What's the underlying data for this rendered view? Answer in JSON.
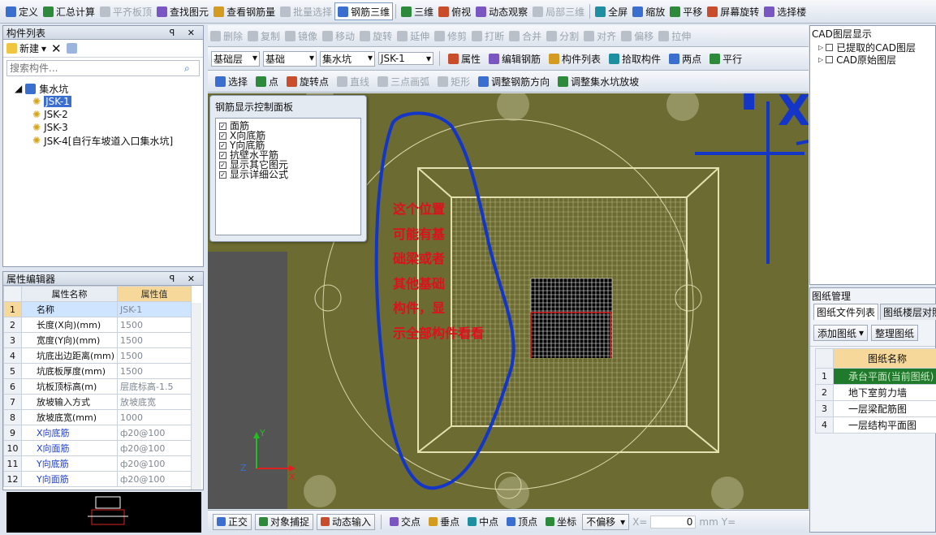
{
  "toolbar1": {
    "items": [
      {
        "icon": "define-icon",
        "label": "定义",
        "disabled": false
      },
      {
        "icon": "sigma-icon",
        "label": "汇总计算",
        "disabled": false
      },
      {
        "icon": "align-slab-icon",
        "label": "平齐板顶",
        "disabled": true
      },
      {
        "icon": "binoculars-icon",
        "label": "查找图元",
        "disabled": false
      },
      {
        "icon": "view-rebar-icon",
        "label": "查看钢筋量",
        "disabled": false
      },
      {
        "icon": "batch-select-icon",
        "label": "批量选择",
        "disabled": true
      },
      {
        "icon": "rebar-3d-icon",
        "label": "钢筋三维",
        "disabled": false
      },
      {
        "icon": "cube-3d-icon",
        "label": "三维",
        "disabled": false
      },
      {
        "icon": "top-view-icon",
        "label": "俯视",
        "disabled": false
      },
      {
        "icon": "orbit-icon",
        "label": "动态观察",
        "disabled": false
      },
      {
        "icon": "local-3d-icon",
        "label": "局部三维",
        "disabled": true
      },
      {
        "icon": "fullscreen-icon",
        "label": "全屏",
        "disabled": false
      },
      {
        "icon": "zoom-icon",
        "label": "缩放",
        "disabled": false
      },
      {
        "icon": "pan-icon",
        "label": "平移",
        "disabled": false
      },
      {
        "icon": "screen-rotate-icon",
        "label": "屏幕旋转",
        "disabled": false
      },
      {
        "icon": "select-floor-icon",
        "label": "选择楼",
        "disabled": false
      }
    ]
  },
  "toolbar2": {
    "items": [
      "删除",
      "复制",
      "镜像",
      "移动",
      "旋转",
      "延伸",
      "修剪",
      "打断",
      "合并",
      "分割",
      "对齐",
      "偏移",
      "拉伸"
    ]
  },
  "toolbar3": {
    "floor": "基础层",
    "category": "基础",
    "type": "集水坑",
    "element": "JSK-1",
    "buttons": [
      "属性",
      "编辑钢筋",
      "构件列表",
      "拾取构件",
      "两点",
      "平行"
    ]
  },
  "toolbar4": {
    "items": [
      "选择",
      "点",
      "旋转点",
      "直线",
      "三点画弧",
      "矩形",
      "调整钢筋方向",
      "调整集水坑放坡"
    ]
  },
  "component_list": {
    "title": "构件列表",
    "new_label": "新建",
    "search_placeholder": "搜索构件...",
    "root": "集水坑",
    "items": [
      "JSK-1",
      "JSK-2",
      "JSK-3",
      "JSK-4[自行车坡道入口集水坑]"
    ],
    "selected_index": 0
  },
  "property_editor": {
    "title": "属性编辑器",
    "col_name": "属性名称",
    "col_value": "属性值",
    "rows": [
      {
        "n": "1",
        "name": "名称",
        "value": "JSK-1",
        "blue": false
      },
      {
        "n": "2",
        "name": "长度(X向)(mm)",
        "value": "1500",
        "blue": false
      },
      {
        "n": "3",
        "name": "宽度(Y向)(mm)",
        "value": "1500",
        "blue": false
      },
      {
        "n": "4",
        "name": "坑底出边距离(mm)",
        "value": "1500",
        "blue": false
      },
      {
        "n": "5",
        "name": "坑底板厚度(mm)",
        "value": "1500",
        "blue": false
      },
      {
        "n": "6",
        "name": "坑板顶标高(m)",
        "value": "层底标高-1.5",
        "blue": false
      },
      {
        "n": "7",
        "name": "放坡输入方式",
        "value": "放坡底宽",
        "blue": false
      },
      {
        "n": "8",
        "name": "放坡底宽(mm)",
        "value": "1000",
        "blue": false
      },
      {
        "n": "9",
        "name": "X向底筋",
        "value": "ф20@100",
        "blue": true
      },
      {
        "n": "10",
        "name": "X向面筋",
        "value": "ф20@100",
        "blue": true
      },
      {
        "n": "11",
        "name": "Y向底筋",
        "value": "ф20@100",
        "blue": true
      },
      {
        "n": "12",
        "name": "Y向面筋",
        "value": "ф20@100",
        "blue": true
      }
    ]
  },
  "rebar_panel": {
    "title": "钢筋显示控制面板",
    "options": [
      "面筋",
      "X向底筋",
      "Y向底筋",
      "抗壁水平筋",
      "显示其它图元",
      "显示详细公式"
    ]
  },
  "annotation": {
    "lines": [
      "这个位置",
      "可能有基",
      "础梁或者",
      "其他基础",
      "构件，显",
      "示全部构件看看"
    ],
    "hand_x": "X",
    "hand_y": "Y"
  },
  "cad_layers": {
    "title": "CAD图层显示",
    "items": [
      "已提取的CAD图层",
      "CAD原始图层"
    ]
  },
  "drawing_mgmt": {
    "title": "图纸管理",
    "tabs": [
      "图纸文件列表",
      "图纸楼层对照"
    ],
    "add_label": "添加图纸",
    "organize_label": "整理图纸",
    "col": "图纸名称",
    "rows": [
      {
        "n": "1",
        "name": "承台平面(当前图纸)"
      },
      {
        "n": "2",
        "name": "地下室剪力墙"
      },
      {
        "n": "3",
        "name": "一层梁配筋图"
      },
      {
        "n": "4",
        "name": "一层结构平面图"
      }
    ]
  },
  "status": {
    "items": [
      "正交",
      "对象捕捉",
      "动态输入",
      "交点",
      "垂点",
      "中点",
      "顶点",
      "坐标"
    ],
    "offset": "不偏移",
    "x_label": "X=",
    "x_value": "0",
    "unit": "mm",
    "y_label": "Y="
  },
  "axes": {
    "x": "X",
    "y": "Y",
    "z": "Z"
  },
  "colors": {
    "canvas": "#6b6b32",
    "grid": "#e6e1b0",
    "annotation": "#e0101a",
    "pen": "#1336c8"
  }
}
